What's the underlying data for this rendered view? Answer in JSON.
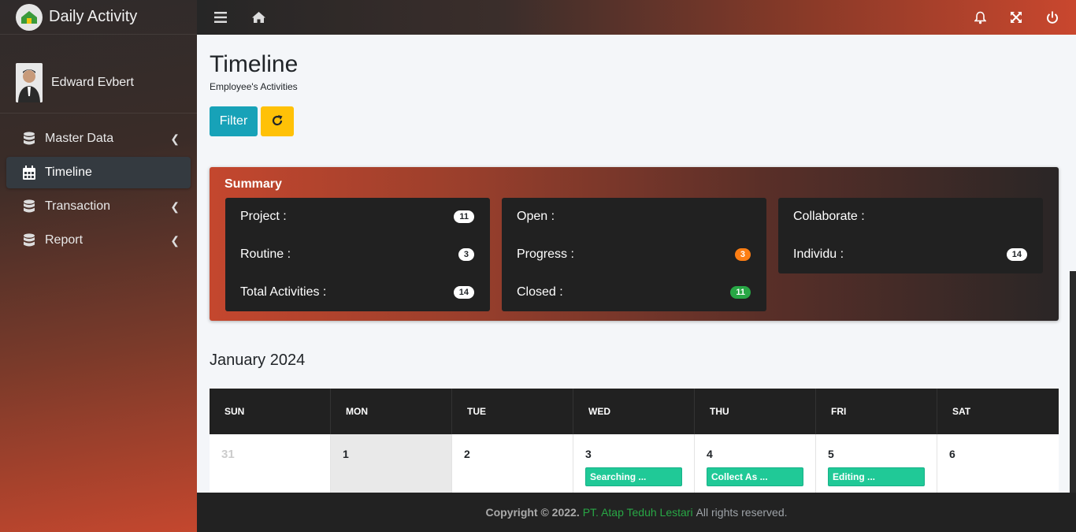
{
  "brand": {
    "name": "Daily Activity"
  },
  "user": {
    "name": "Edward Evbert"
  },
  "sidebar": {
    "items": [
      {
        "label": "Master Data",
        "icon": "database-icon",
        "has_children": true,
        "active": false
      },
      {
        "label": "Timeline",
        "icon": "calendar-icon",
        "has_children": false,
        "active": true
      },
      {
        "label": "Transaction",
        "icon": "database-icon",
        "has_children": true,
        "active": false
      },
      {
        "label": "Report",
        "icon": "database-icon",
        "has_children": true,
        "active": false
      }
    ]
  },
  "topbar": {
    "left_icons": [
      "menu-icon",
      "home-icon"
    ],
    "right_icons": [
      "bell-icon",
      "fullscreen-icon",
      "power-icon"
    ]
  },
  "page": {
    "title": "Timeline",
    "subtitle": "Employee's Activities",
    "filter_label": "Filter"
  },
  "summary": {
    "title": "Summary",
    "cards": [
      {
        "rows": [
          {
            "label": "Project :",
            "value": "11",
            "color": "#ffffff"
          },
          {
            "label": "Routine :",
            "value": "3",
            "color": "#ffffff"
          },
          {
            "label": "Total Activities :",
            "value": "14",
            "color": "#ffffff"
          }
        ]
      },
      {
        "rows": [
          {
            "label": "Open :",
            "value": "",
            "color": ""
          },
          {
            "label": "Progress :",
            "value": "3",
            "color": "#fd7e14"
          },
          {
            "label": "Closed :",
            "value": "11",
            "color": "#28a745"
          }
        ]
      },
      {
        "rows": [
          {
            "label": "Collaborate :",
            "value": "",
            "color": ""
          },
          {
            "label": "Individu :",
            "value": "14",
            "color": "#ffffff"
          }
        ]
      }
    ]
  },
  "calendar": {
    "month": "January 2024",
    "days": [
      "SUN",
      "MON",
      "TUE",
      "WED",
      "THU",
      "FRI",
      "SAT"
    ],
    "week": [
      {
        "date": "31",
        "event": "",
        "muted": true
      },
      {
        "date": "1",
        "event": ""
      },
      {
        "date": "2",
        "event": ""
      },
      {
        "date": "3",
        "event": "Searching ..."
      },
      {
        "date": "4",
        "event": "Collect As ..."
      },
      {
        "date": "5",
        "event": "Editing ..."
      },
      {
        "date": "6",
        "event": ""
      }
    ]
  },
  "footer": {
    "copyright": "Copyright © 2022.",
    "company": "PT. Atap Teduh Lestari",
    "rights": "All rights reserved."
  },
  "colors": {
    "accent": "#c4472e",
    "info": "#17a2b8",
    "warning": "#ffc107",
    "event": "#20c997"
  }
}
